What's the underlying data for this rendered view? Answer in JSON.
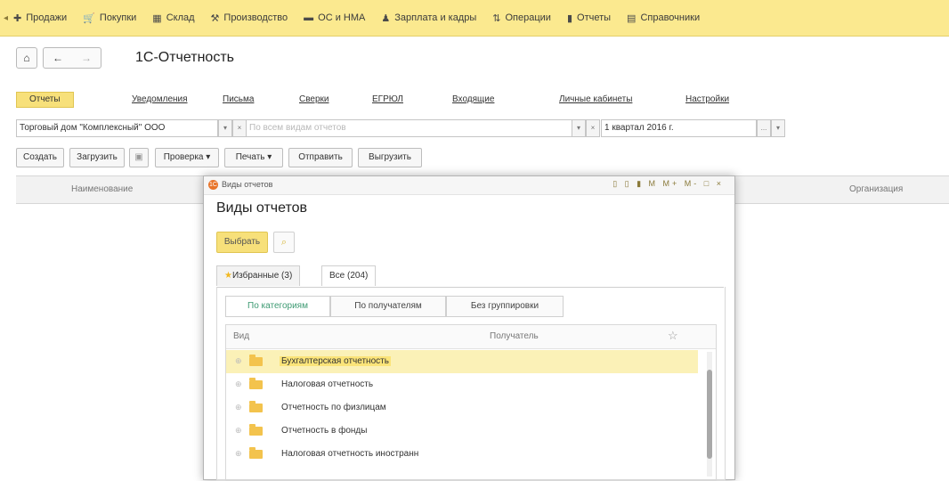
{
  "top_menu": [
    {
      "label": "Продажи",
      "icon": "sales-icon",
      "glyph": "✚"
    },
    {
      "label": "Покупки",
      "icon": "cart-icon",
      "glyph": "🛒"
    },
    {
      "label": "Склад",
      "icon": "warehouse-icon",
      "glyph": "▦"
    },
    {
      "label": "Производство",
      "icon": "production-icon",
      "glyph": "⚒"
    },
    {
      "label": "ОС и НМА",
      "icon": "assets-icon",
      "glyph": "▬"
    },
    {
      "label": "Зарплата и кадры",
      "icon": "staff-icon",
      "glyph": "♟"
    },
    {
      "label": "Операции",
      "icon": "operations-icon",
      "glyph": "⇅"
    },
    {
      "label": "Отчеты",
      "icon": "reports-icon",
      "glyph": "▮"
    },
    {
      "label": "Справочники",
      "icon": "catalogs-icon",
      "glyph": "▤"
    }
  ],
  "nav": {
    "home_icon": "⌂",
    "back_icon": "←",
    "forward_icon": "→"
  },
  "page": {
    "title": "1С-Отчетность"
  },
  "tabs": [
    "Отчеты",
    "Уведомления",
    "Письма",
    "Сверки",
    "ЕГРЮЛ",
    "Входящие",
    "Личные кабинеты",
    "Настройки"
  ],
  "filters": {
    "organization": "Торговый дом \"Комплексный\" ООО",
    "report_types_placeholder": "По всем видам отчетов",
    "period": "1 квартал 2016 г.",
    "dropdown_glyph": "▾",
    "clear_glyph": "×",
    "ellipsis_glyph": "..."
  },
  "commands": {
    "create": "Создать",
    "load": "Загрузить",
    "check": "Проверка ▾",
    "print": "Печать ▾",
    "send": "Отправить",
    "export": "Выгрузить"
  },
  "grid": {
    "col_name": "Наименование",
    "col_org": "Организация"
  },
  "dialog": {
    "window_title": "Виды отчетов",
    "heading": "Виды отчетов",
    "controls": "▯ ▯ ▮ M M+ M- □ ×",
    "choose": "Выбрать",
    "tab_favorites": "Избранные (3)",
    "tab_all": "Все (204)",
    "group_buttons": [
      "По категориям",
      "По получателям",
      "Без группировки"
    ],
    "col_kind": "Вид",
    "col_recipient": "Получатель",
    "star": "☆",
    "rows": [
      "Бухгалтерская отчетность",
      "Налоговая отчетность",
      "Отчетность по физлицам",
      "Отчетность в фонды",
      "Налоговая отчетность иностранн"
    ]
  }
}
